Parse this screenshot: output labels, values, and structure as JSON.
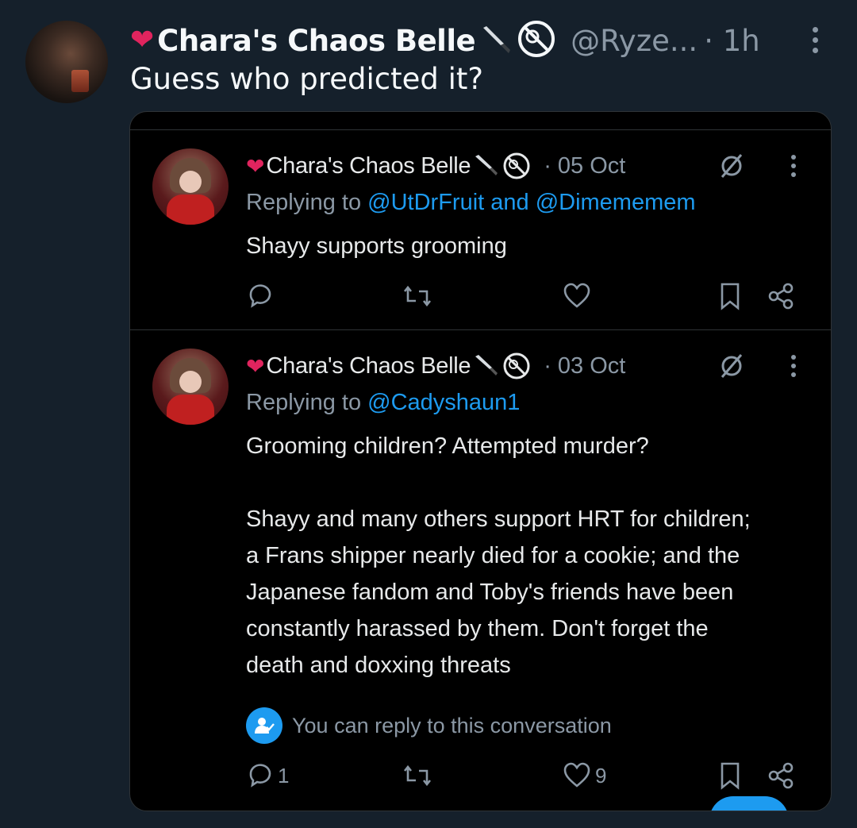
{
  "outer_tweet": {
    "display_name": "Chara's Chaos Belle",
    "handle": "@Ryze...",
    "time": "· 1h",
    "text": "Guess who predicted it?"
  },
  "embedded": {
    "post1": {
      "name": "Chara's Chaos Belle",
      "date": "· 05 Oct",
      "replying_prefix": "Replying to ",
      "replying_to": "@UtDrFruit and @Dimememem",
      "body": [
        "Shayy supports grooming"
      ]
    },
    "post2": {
      "name": "Chara's Chaos Belle",
      "date": "· 03 Oct",
      "replying_prefix": "Replying to ",
      "replying_to": "@Cadyshaun1",
      "body_para1": "Grooming children? Attempted murder?",
      "body_para2": [
        "Shayy and many others support HRT for children;",
        "a Frans shipper nearly died for a cookie; and the",
        "Japanese fandom and Toby's friends have been",
        "constantly harassed by them. Don't forget the",
        "death and doxxing threats"
      ],
      "reply_hint": "You can reply to this conversation",
      "reply_count": "1",
      "like_count": "9"
    }
  },
  "colors": {
    "background": "#15202b",
    "card": "#000000",
    "accent": "#1d9bf0",
    "heart": "#e0245e",
    "muted": "#8b98a5"
  }
}
